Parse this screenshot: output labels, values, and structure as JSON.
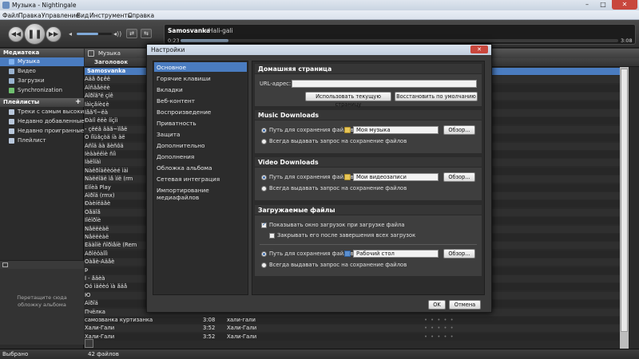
{
  "window": {
    "title": "Музыка - Nightingale",
    "min": "–",
    "max": "□",
    "close": "✕"
  },
  "menu": [
    "Файл",
    "Правка",
    "Управление",
    "Вид",
    "Инструменты",
    "Справка"
  ],
  "player": {
    "prev": "◀◀",
    "play": "❚❚",
    "next": "▶▶",
    "volume_low": "◂",
    "volume_high": "◂))",
    "volume_level": 0.62,
    "repeat_icon": "⇄",
    "shuffle_icon": "⇆",
    "artist": "Samosvanka",
    "separator": "•",
    "track": "Hali-gali",
    "elapsed": "0:23",
    "total": "3:08",
    "progress": 0.11
  },
  "sidebar": {
    "library_header": "Медиатека",
    "library_items": [
      {
        "label": "Музыка",
        "selected": true,
        "color": "#7fb2f0"
      },
      {
        "label": "Видео",
        "selected": false,
        "color": "#9ab3d0"
      },
      {
        "label": "Загрузки",
        "selected": false,
        "color": "#9ab3d0"
      },
      {
        "label": "Synchronization",
        "selected": false,
        "color": "#6fbf6f"
      }
    ],
    "playlists_header": "Плейлисты",
    "add_icon": "+",
    "playlist_items": [
      "Треки с самым высоки...",
      "Недавно добавленные ...",
      "Недавно проигранные ...",
      "Плейлист"
    ],
    "art_placeholder": "Перетащите сюда обложку альбома"
  },
  "tracklist": {
    "tab_label": "Музыка",
    "columns": {
      "title": "Заголовок"
    },
    "rows": [
      {
        "title": "Samosvanka",
        "time": "",
        "artist": "",
        "group": true
      },
      {
        "title": "Ääã ð¢êë",
        "time": "",
        "artist": ""
      },
      {
        "title": "Äîñãåëëè",
        "time": "",
        "artist": ""
      },
      {
        "title": "Äîðîã³ë çíê",
        "time": "",
        "artist": ""
      },
      {
        "title": "Ìàìçåíè¢è",
        "time": "",
        "artist": ""
      },
      {
        "title": "Ìåã³î~ëà",
        "time": "",
        "artist": ""
      },
      {
        "title": "Ðàiî êëè ííçìì",
        "time": "",
        "artist": ""
      },
      {
        "title": "- çëéâ ääã~ìîåë",
        "time": "",
        "artist": ""
      },
      {
        "title": "Ò íîüâçòä íà äë",
        "time": "",
        "artist": ""
      },
      {
        "title": "Àñîä äà åèñôä",
        "time": "",
        "artist": ""
      },
      {
        "title": "Ìèäàëëìè ñíì",
        "time": "",
        "artist": ""
      },
      {
        "title": "Íàëîíàì",
        "time": "",
        "artist": ""
      },
      {
        "title": "Ñàêðîäêèóèé ìàì",
        "time": "",
        "artist": ""
      },
      {
        "title": "Ñàëéîãë ìå ìíë (rm",
        "time": "",
        "artist": ""
      },
      {
        "title": "Ëìîèä Play",
        "time": "",
        "artist": ""
      },
      {
        "title": "Àìðîä (rmx)",
        "time": "",
        "artist": ""
      },
      {
        "title": "Ðàèíëäãè",
        "time": "",
        "artist": ""
      },
      {
        "title": "Òåäîå",
        "time": "",
        "artist": ""
      },
      {
        "title": "Ïîëîðîè",
        "time": "",
        "artist": ""
      },
      {
        "title": "Ñåëëèàë",
        "time": "",
        "artist": ""
      },
      {
        "title": "Ñåëëèàë",
        "time": "",
        "artist": ""
      },
      {
        "title": "Ëäàîíè ñîðìåíè (Rem",
        "time": "",
        "artist": ""
      },
      {
        "title": "Àðîëôàîîì",
        "time": "",
        "artist": ""
      },
      {
        "title": "Òàåè-Àäåè",
        "time": "",
        "artist": ""
      },
      {
        "title": "Þ",
        "time": "",
        "artist": ""
      },
      {
        "title": "Ì - åäèà",
        "time": "",
        "artist": ""
      },
      {
        "title": "Óó ìäëèó ìà åäå",
        "time": "",
        "artist": ""
      },
      {
        "title": "Ю",
        "time": "",
        "artist": ""
      },
      {
        "title": "Àïðîä",
        "time": "",
        "artist": ""
      },
      {
        "title": "Пчёлка",
        "time": "",
        "artist": ""
      },
      {
        "title": "самозванка куртизанка",
        "time": "3:08",
        "artist": "хали-гали"
      },
      {
        "title": "Хали-Гали",
        "time": "3:52",
        "artist": "Хали-Гали"
      },
      {
        "title": "Хали-Гали",
        "time": "3:52",
        "artist": "Хали-Гали"
      }
    ],
    "rating_stars": "• • • • •"
  },
  "status": {
    "left": "Выбрано",
    "count": "42 файлов"
  },
  "dialog": {
    "title": "Настройки",
    "close": "✕",
    "nav": [
      {
        "label": "Основное",
        "selected": true
      },
      {
        "label": "Горячие клавиши",
        "selected": false
      },
      {
        "label": "Вкладки",
        "selected": false
      },
      {
        "label": "Веб-контент",
        "selected": false
      },
      {
        "label": "Воспроизведение",
        "selected": false
      },
      {
        "label": "Приватность",
        "selected": false
      },
      {
        "label": "Защита",
        "selected": false
      },
      {
        "label": "Дополнительно",
        "selected": false
      },
      {
        "label": "Дополнения",
        "selected": false
      },
      {
        "label": "Обложка альбома",
        "selected": false
      },
      {
        "label": "Сетевая интеграция",
        "selected": false
      },
      {
        "label": "Импортирование медиафайлов",
        "selected": false
      }
    ],
    "home": {
      "header": "Домашняя страница",
      "url_label": "URL-адрес:",
      "url_value": "",
      "use_current": "Использовать текущую страницу",
      "restore_default": "Восстановить по умолчанию"
    },
    "music": {
      "header": "Music Downloads",
      "save_path_label": "Путь для сохранения файлов",
      "folder": "Моя музыка",
      "browse": "Обзор...",
      "always_ask": "Всегда выдавать запрос на сохранение файлов"
    },
    "video": {
      "header": "Video Downloads",
      "save_path_label": "Путь для сохранения файлов",
      "folder": "Мои видеозаписи",
      "browse": "Обзор...",
      "always_ask": "Всегда выдавать запрос на сохранение файлов"
    },
    "downloads": {
      "header": "Загружаемые файлы",
      "show_window": "Показывать окно загрузок при загрузке файла",
      "close_after": "Закрывать его после завершения всех загрузок",
      "save_path_label": "Путь для сохранения файлов",
      "folder": "Рабочий стол",
      "browse": "Обзор...",
      "always_ask": "Всегда выдавать запрос на сохранение файлов"
    },
    "ok": "OK",
    "cancel": "Отмена"
  }
}
